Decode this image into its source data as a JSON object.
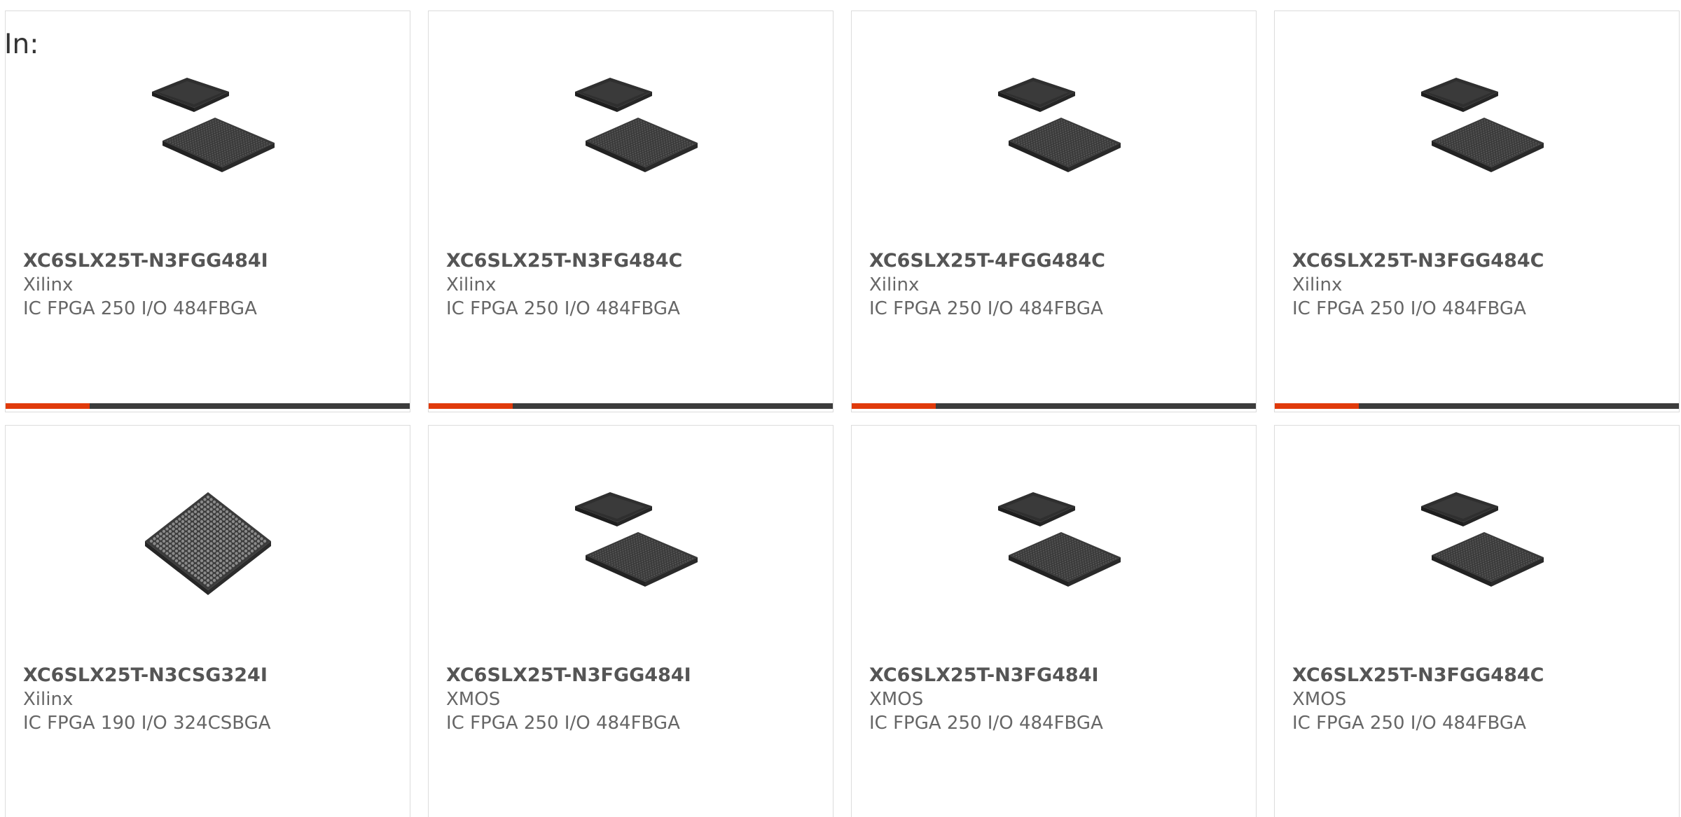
{
  "header": {
    "label": "In:"
  },
  "colors": {
    "accent": "#e03a0b",
    "bar_track": "#3c3c3c",
    "card_border": "#dcdcdc"
  },
  "products": [
    {
      "part_number": "XC6SLX25T-N3FGG484I",
      "manufacturer": "Xilinx",
      "description": "IC FPGA 250 I/O 484FBGA",
      "image_icon": "bga-chip-stack-icon"
    },
    {
      "part_number": "XC6SLX25T-N3FG484C",
      "manufacturer": "Xilinx",
      "description": "IC FPGA 250 I/O 484FBGA",
      "image_icon": "bga-chip-stack-icon"
    },
    {
      "part_number": "XC6SLX25T-4FGG484C",
      "manufacturer": "Xilinx",
      "description": "IC FPGA 250 I/O 484FBGA",
      "image_icon": "bga-chip-stack-icon"
    },
    {
      "part_number": "XC6SLX25T-N3FGG484C",
      "manufacturer": "Xilinx",
      "description": "IC FPGA 250 I/O 484FBGA",
      "image_icon": "bga-chip-stack-icon"
    },
    {
      "part_number": "XC6SLX25T-N3CSG324I",
      "manufacturer": "Xilinx",
      "description": "IC FPGA 190 I/O 324CSBGA",
      "image_icon": "bga-chip-single-icon"
    },
    {
      "part_number": "XC6SLX25T-N3FGG484I",
      "manufacturer": "XMOS",
      "description": "IC FPGA 250 I/O 484FBGA",
      "image_icon": "bga-chip-stack-icon"
    },
    {
      "part_number": "XC6SLX25T-N3FG484I",
      "manufacturer": "XMOS",
      "description": "IC FPGA 250 I/O 484FBGA",
      "image_icon": "bga-chip-stack-icon"
    },
    {
      "part_number": "XC6SLX25T-N3FGG484C",
      "manufacturer": "XMOS",
      "description": "IC FPGA 250 I/O 484FBGA",
      "image_icon": "bga-chip-stack-icon"
    }
  ]
}
